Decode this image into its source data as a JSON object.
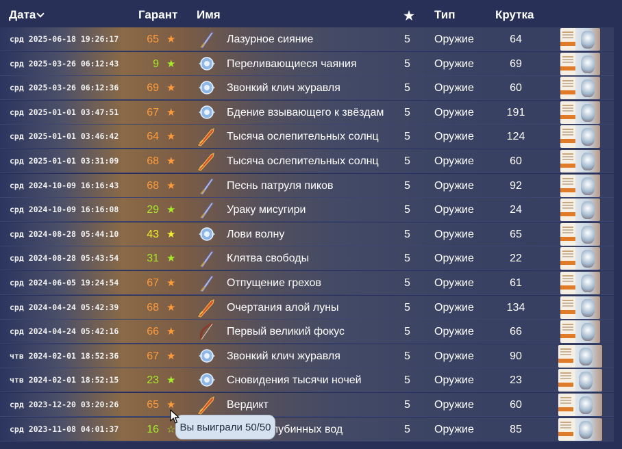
{
  "header": {
    "date": "Дата",
    "garant": "Гарант",
    "name": "Имя",
    "rarity": "★",
    "type": "Тип",
    "roll": "Крутка"
  },
  "colors": {
    "pity_orange": "#ff9b3a",
    "pity_green": "#a6ea2a",
    "pity_yellow": "#f5ef2d",
    "header_bg": "#283057"
  },
  "rows": [
    {
      "date": "срд 2025-06-18 19:26:17",
      "pity": "65",
      "pity_color": "orange",
      "star": "★",
      "name": "Лазурное сияние",
      "rarity": "5",
      "type": "Оружие",
      "roll": "64",
      "icon": "sword-icon"
    },
    {
      "date": "срд 2025-03-26 06:12:43",
      "pity": "9",
      "pity_color": "green",
      "star": "★",
      "name": "Переливающиеся чаяния",
      "rarity": "5",
      "type": "Оружие",
      "roll": "69",
      "icon": "catalyst-icon"
    },
    {
      "date": "срд 2025-03-26 06:12:36",
      "pity": "69",
      "pity_color": "orange",
      "star": "★",
      "name": "Звонкий клич журавля",
      "rarity": "5",
      "type": "Оружие",
      "roll": "60",
      "icon": "catalyst-icon"
    },
    {
      "date": "срд 2025-01-01 03:47:51",
      "pity": "67",
      "pity_color": "orange",
      "star": "★",
      "name": "Бдение взывающего к звёздам",
      "rarity": "5",
      "type": "Оружие",
      "roll": "191",
      "icon": "catalyst-icon"
    },
    {
      "date": "срд 2025-01-01 03:46:42",
      "pity": "64",
      "pity_color": "orange",
      "star": "★",
      "name": "Тысяча ослепительных солнц",
      "rarity": "5",
      "type": "Оружие",
      "roll": "124",
      "icon": "claymore-icon"
    },
    {
      "date": "срд 2025-01-01 03:31:09",
      "pity": "68",
      "pity_color": "orange",
      "star": "★",
      "name": "Тысяча ослепительных солнц",
      "rarity": "5",
      "type": "Оружие",
      "roll": "60",
      "icon": "claymore-icon"
    },
    {
      "date": "срд 2024-10-09 16:16:43",
      "pity": "68",
      "pity_color": "orange",
      "star": "★",
      "name": "Песнь патруля пиков",
      "rarity": "5",
      "type": "Оружие",
      "roll": "92",
      "icon": "sword-icon"
    },
    {
      "date": "срд 2024-10-09 16:16:08",
      "pity": "29",
      "pity_color": "green",
      "star": "★",
      "name": "Ураку мисугири",
      "rarity": "5",
      "type": "Оружие",
      "roll": "24",
      "icon": "sword-icon"
    },
    {
      "date": "срд 2024-08-28 05:44:10",
      "pity": "43",
      "pity_color": "yellow",
      "star": "★",
      "name": "Лови волну",
      "rarity": "5",
      "type": "Оружие",
      "roll": "65",
      "icon": "catalyst-icon"
    },
    {
      "date": "срд 2024-08-28 05:43:54",
      "pity": "31",
      "pity_color": "green",
      "star": "★",
      "name": "Клятва свободы",
      "rarity": "5",
      "type": "Оружие",
      "roll": "22",
      "icon": "sword-icon"
    },
    {
      "date": "срд 2024-06-05 19:24:54",
      "pity": "67",
      "pity_color": "orange",
      "star": "★",
      "name": "Отпущение грехов",
      "rarity": "5",
      "type": "Оружие",
      "roll": "61",
      "icon": "sword-icon"
    },
    {
      "date": "срд 2024-04-24 05:42:39",
      "pity": "68",
      "pity_color": "orange",
      "star": "★",
      "name": "Очертания алой луны",
      "rarity": "5",
      "type": "Оружие",
      "roll": "134",
      "icon": "claymore-icon"
    },
    {
      "date": "срд 2024-04-24 05:42:16",
      "pity": "66",
      "pity_color": "orange",
      "star": "★",
      "name": "Первый великий фокус",
      "rarity": "5",
      "type": "Оружие",
      "roll": "66",
      "icon": "bow-icon"
    },
    {
      "date": "чтв 2024-02-01 18:52:36",
      "pity": "67",
      "pity_color": "orange",
      "star": "★",
      "name": "Звонкий клич журавля",
      "rarity": "5",
      "type": "Оружие",
      "roll": "90",
      "icon": "catalyst-icon"
    },
    {
      "date": "чтв 2024-02-01 18:52:15",
      "pity": "23",
      "pity_color": "green",
      "star": "★",
      "name": "Сновидения тысячи ночей",
      "rarity": "5",
      "type": "Оружие",
      "roll": "23",
      "icon": "catalyst-icon"
    },
    {
      "date": "срд 2023-12-20 03:20:26",
      "pity": "65",
      "pity_color": "orange",
      "star": "★",
      "name": "Вердикт",
      "rarity": "5",
      "type": "Оружие",
      "roll": "60",
      "icon": "claymore-icon"
    },
    {
      "date": "срд 2023-11-08 04:01:37",
      "pity": "16",
      "pity_color": "green",
      "star": "☆",
      "name": "Сияние глубинных вод",
      "rarity": "5",
      "type": "Оружие",
      "roll": "85",
      "icon": "sword-icon"
    }
  ],
  "tooltip": {
    "text": "Вы выиграли 50/50"
  }
}
